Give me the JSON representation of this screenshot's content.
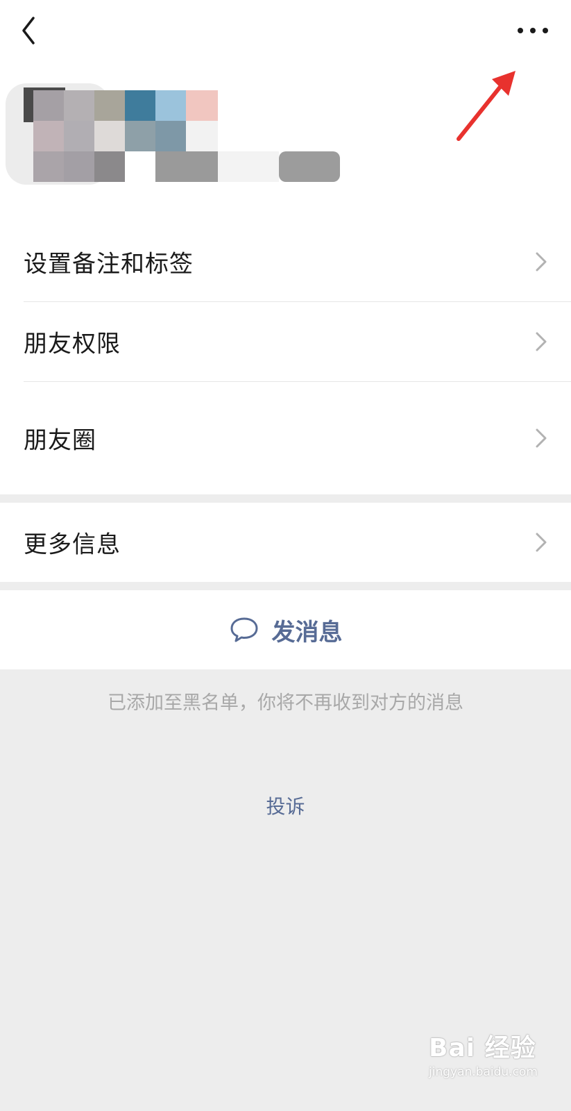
{
  "menu": {
    "items": [
      {
        "label": "设置备注和标签"
      },
      {
        "label": "朋友权限"
      },
      {
        "label": "朋友圈"
      }
    ],
    "more_info": {
      "label": "更多信息"
    }
  },
  "actions": {
    "send_message": {
      "label": "发消息",
      "icon": "chat-bubble-icon"
    }
  },
  "notice": {
    "text": "已添加至黑名单，你将不再收到对方的消息"
  },
  "complain": {
    "label": "投诉"
  },
  "watermark": {
    "brand": "Bai 经验",
    "url": "jingyan.baidu.com"
  },
  "colors": {
    "accent": "#576b95",
    "background": "#ededed",
    "annotation_arrow": "#e8322e"
  }
}
